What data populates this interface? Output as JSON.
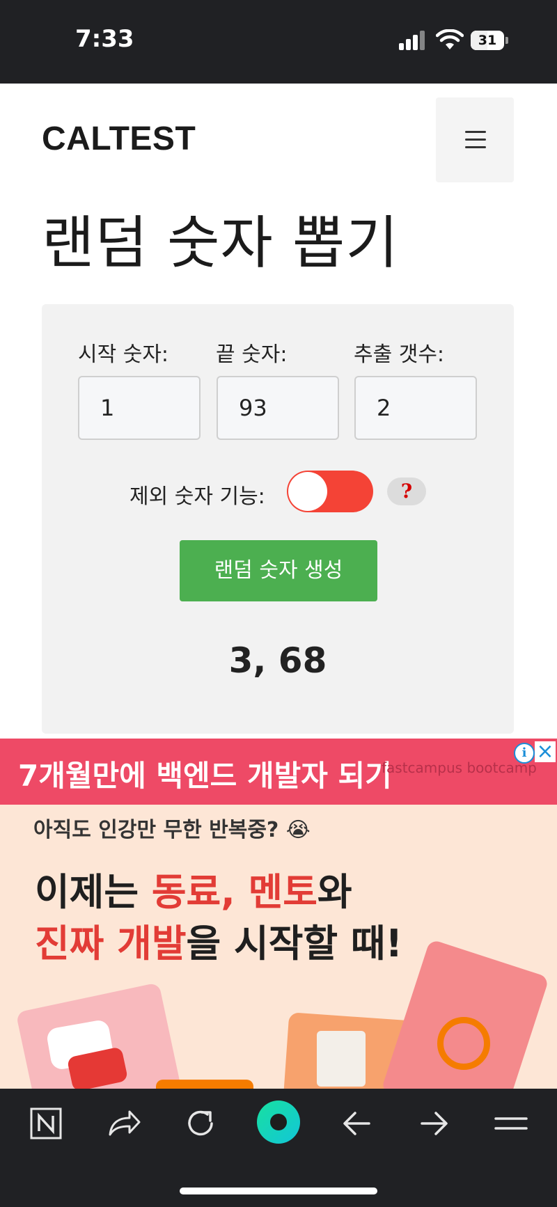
{
  "status_bar": {
    "time": "7:33",
    "battery": "31",
    "icons": [
      "cellular-signal-icon",
      "wifi-icon",
      "battery-icon"
    ]
  },
  "header": {
    "logo": "CALTEST",
    "menu_icon": "hamburger-menu-icon"
  },
  "page": {
    "title": "랜덤 숫자 뽑기"
  },
  "form": {
    "start": {
      "label": "시작 숫자:",
      "value": "1"
    },
    "end": {
      "label": "끝 숫자:",
      "value": "93"
    },
    "count": {
      "label": "추출 갯수:",
      "value": "2"
    },
    "exclude": {
      "label": "제외 숫자 기능:",
      "enabled": false,
      "help": "?"
    },
    "generate_label": "랜덤 숫자 생성",
    "result": "3, 68"
  },
  "ad": {
    "headline": "7개월만에 백엔드 개발자 되기",
    "brand": "fastcampus bootcamp",
    "sub": "아직도 인강만 무한 반복중? 😭",
    "line1": [
      "이제는 ",
      "동료, 멘토",
      "와"
    ],
    "line2": [
      "진짜 개발",
      "을 시작할 때!"
    ],
    "colors": {
      "header": "#ee4a66",
      "background": "#fde6d6",
      "highlight": "#e23c36"
    }
  },
  "toolbar": {
    "items": [
      "naver-logo-icon",
      "share-icon",
      "reload-icon",
      "home-circle-icon",
      "back-arrow-icon",
      "forward-arrow-icon",
      "menu-icon"
    ]
  },
  "colors": {
    "toggle": "#f44336",
    "button": "#4caf50",
    "card": "#f2f2f2"
  }
}
